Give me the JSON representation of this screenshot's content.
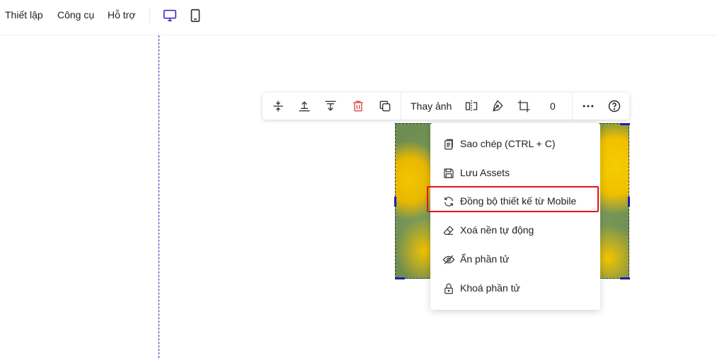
{
  "topbar": {
    "menu": [
      {
        "label": "Thiết lập"
      },
      {
        "label": "Công cụ"
      },
      {
        "label": "Hỗ trợ"
      }
    ],
    "devices": [
      {
        "icon": "desktop-icon",
        "active": true,
        "color": "#3b2fc9"
      },
      {
        "icon": "tablet-icon",
        "active": false,
        "color": "#333333"
      }
    ]
  },
  "toolbar": {
    "icons": [
      "vertical-distribute-icon",
      "align-top-icon",
      "align-bottom-icon",
      "trash-icon",
      "duplicate-icon"
    ],
    "replace_image_label": "Thay ảnh",
    "more_icons": [
      "flip-icon",
      "pen-tool-icon",
      "crop-icon"
    ],
    "value": "0",
    "trailing_icons": [
      "more-icon",
      "help-icon"
    ],
    "delete_color": "#e34141"
  },
  "context_menu": {
    "items": [
      {
        "icon": "copy-doc-icon",
        "label": "Sao chép (CTRL + C)"
      },
      {
        "icon": "save-icon",
        "label": "Lưu Assets"
      },
      {
        "icon": "sync-icon",
        "label": "Đồng bộ thiết kế từ Mobile",
        "highlighted": true
      },
      {
        "icon": "eraser-icon",
        "label": "Xoá nền tự động"
      },
      {
        "icon": "eye-off-icon",
        "label": "Ẩn phần tử"
      },
      {
        "icon": "lock-icon",
        "label": "Khoá phần tử"
      }
    ],
    "highlight_color": "#e3141b"
  },
  "colors": {
    "accent": "#3b2fc9",
    "guide": "#2a2aa8",
    "selection_handle": "#1f1fb0"
  }
}
